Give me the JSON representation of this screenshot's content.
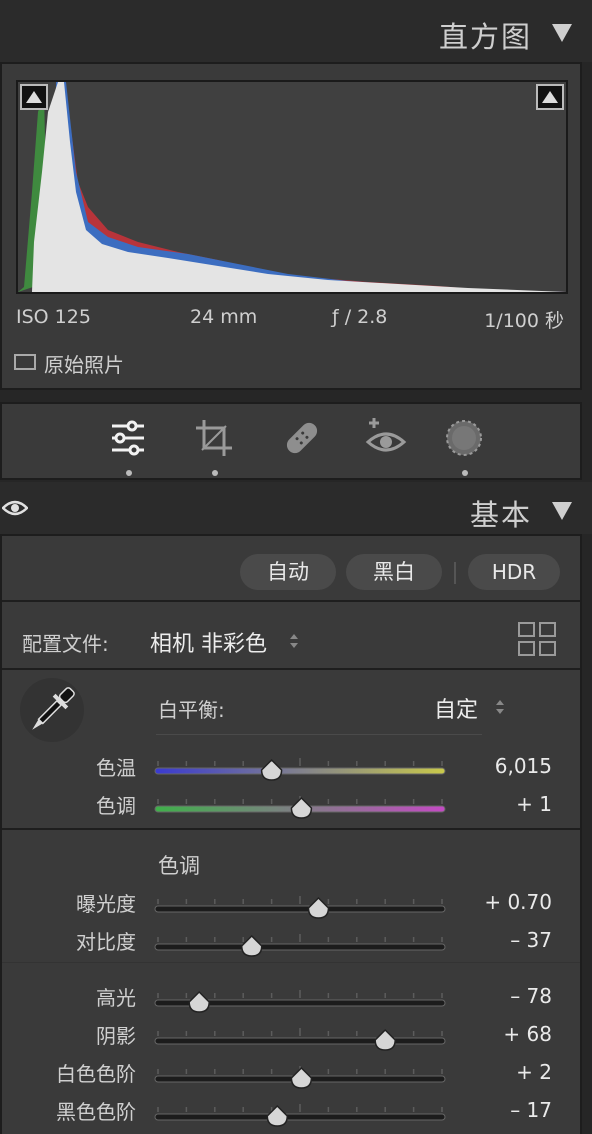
{
  "histogram_panel": {
    "title": "直方图",
    "iso": "ISO 125",
    "focal": "24 mm",
    "aperture": "ƒ / 2.8",
    "shutter": "1/100 秒",
    "original_photo_label": "原始照片"
  },
  "tools": {
    "items": [
      "sliders-icon",
      "crop-icon",
      "heal-icon",
      "redeye-icon",
      "mask-icon"
    ],
    "active": "sliders-icon"
  },
  "basic_panel": {
    "title": "基本",
    "auto_label": "自动",
    "bw_label": "黑白",
    "hdr_label": "HDR",
    "profile_label": "配置文件:",
    "profile_value": "相机 非彩色",
    "wb_label": "白平衡:",
    "wb_value": "自定",
    "temp": {
      "label": "色温",
      "value": "6,015",
      "position": 0.4
    },
    "tint": {
      "label": "色调",
      "value": "+ 1",
      "position": 0.505
    },
    "tone_heading": "色调",
    "exposure": {
      "label": "曝光度",
      "value": "+ 0.70",
      "position": 0.565
    },
    "contrast": {
      "label": "对比度",
      "value": "– 37",
      "position": 0.33
    },
    "highlights": {
      "label": "高光",
      "value": "– 78",
      "position": 0.145
    },
    "shadows": {
      "label": "阴影",
      "value": "+ 68",
      "position": 0.8
    },
    "whites": {
      "label": "白色色阶",
      "value": "+ 2",
      "position": 0.505
    },
    "blacks": {
      "label": "黑色色阶",
      "value": "– 17",
      "position": 0.42
    }
  },
  "colors": {
    "temp_gradient": [
      "#3a3ad0",
      "#c9c94a"
    ],
    "tint_gradient": [
      "#3fb04a",
      "#c44ac4"
    ]
  }
}
